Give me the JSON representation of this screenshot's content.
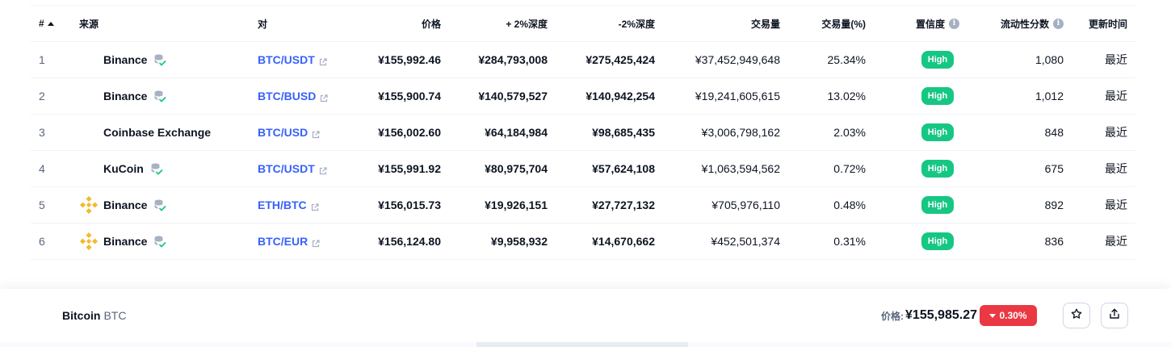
{
  "table": {
    "headers": {
      "rank": "#",
      "source": "来源",
      "pair": "对",
      "price": "价格",
      "depth_plus": "+ 2%深度",
      "depth_minus": "-2%深度",
      "volume": "交易量",
      "volume_pct": "交易量(%)",
      "confidence": "置信度",
      "liquidity": "流动性分数",
      "updated": "更新时间"
    },
    "rows": [
      {
        "rank": "1",
        "source": "Binance",
        "logo": false,
        "pair": "BTC/USDT",
        "price": "¥155,992.46",
        "depth_plus": "¥284,793,008",
        "depth_minus": "¥275,425,424",
        "volume": "¥37,452,949,648",
        "volume_pct": "25.34%",
        "confidence": "High",
        "liquidity": "1,080",
        "updated": "最近"
      },
      {
        "rank": "2",
        "source": "Binance",
        "logo": false,
        "pair": "BTC/BUSD",
        "price": "¥155,900.74",
        "depth_plus": "¥140,579,527",
        "depth_minus": "¥140,942,254",
        "volume": "¥19,241,605,615",
        "volume_pct": "13.02%",
        "confidence": "High",
        "liquidity": "1,012",
        "updated": "最近"
      },
      {
        "rank": "3",
        "source": "Coinbase Exchange",
        "logo": false,
        "pair": "BTC/USD",
        "price": "¥156,002.60",
        "depth_plus": "¥64,184,984",
        "depth_minus": "¥98,685,435",
        "volume": "¥3,006,798,162",
        "volume_pct": "2.03%",
        "confidence": "High",
        "liquidity": "848",
        "updated": "最近"
      },
      {
        "rank": "4",
        "source": "KuCoin",
        "logo": false,
        "pair": "BTC/USDT",
        "price": "¥155,991.92",
        "depth_plus": "¥80,975,704",
        "depth_minus": "¥57,624,108",
        "volume": "¥1,063,594,562",
        "volume_pct": "0.72%",
        "confidence": "High",
        "liquidity": "675",
        "updated": "最近"
      },
      {
        "rank": "5",
        "source": "Binance",
        "logo": true,
        "pair": "ETH/BTC",
        "price": "¥156,015.73",
        "depth_plus": "¥19,926,151",
        "depth_minus": "¥27,727,132",
        "volume": "¥705,976,110",
        "volume_pct": "0.48%",
        "confidence": "High",
        "liquidity": "892",
        "updated": "最近"
      },
      {
        "rank": "6",
        "source": "Binance",
        "logo": true,
        "pair": "BTC/EUR",
        "price": "¥156,124.80",
        "depth_plus": "¥9,958,932",
        "depth_minus": "¥14,670,662",
        "volume": "¥452,501,374",
        "volume_pct": "0.31%",
        "confidence": "High",
        "liquidity": "836",
        "updated": "最近"
      }
    ]
  },
  "bottom_bar": {
    "coin_name": "Bitcoin",
    "coin_symbol": "BTC",
    "price_label": "价格:",
    "price_value": "¥155,985.27",
    "change": "0.30%"
  },
  "colors": {
    "accent_link": "#3861fb",
    "high_badge": "#16c784",
    "down_badge": "#ea3943",
    "binance_logo": "#f3ba2f"
  },
  "icons": {
    "sort": "sort-ascending-icon",
    "info": "info-icon",
    "database_verified": "database-check-icon",
    "external_link": "external-link-icon",
    "star": "star-icon",
    "share": "share-icon"
  }
}
